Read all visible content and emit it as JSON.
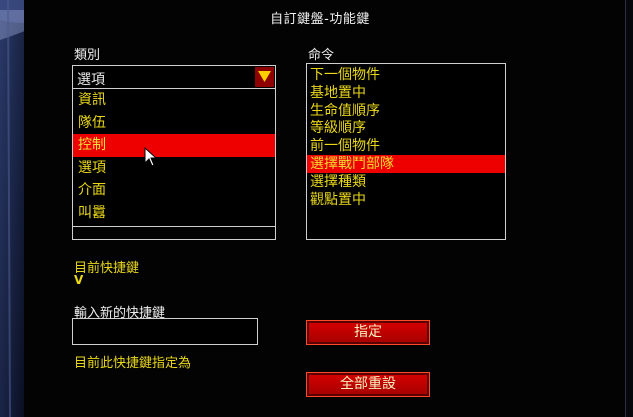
{
  "dialog": {
    "title": "自訂鍵盤-功能鍵"
  },
  "category": {
    "label": "類別",
    "selected_value": "選項",
    "items": [
      "資訊",
      "隊伍",
      "控制",
      "選項",
      "介面",
      "叫囂"
    ],
    "selected_index": 2
  },
  "command": {
    "label": "命令",
    "items": [
      "下一個物件",
      "基地置中",
      "生命值順序",
      "等級順序",
      "前一個物件",
      "選擇戰鬥部隊",
      "選擇種類",
      "觀點置中"
    ],
    "selected_index": 5
  },
  "hotkey": {
    "current_label": "目前快捷鍵",
    "current_value": "V",
    "new_label": "輸入新的快捷鍵",
    "new_value": "",
    "assigned_label": "目前此快捷鍵指定為"
  },
  "buttons": {
    "assign": "指定",
    "reset_all": "全部重設"
  },
  "colors": {
    "highlight": "#ee0000",
    "text_yellow": "#e9d718",
    "button_red": "#c00000"
  }
}
